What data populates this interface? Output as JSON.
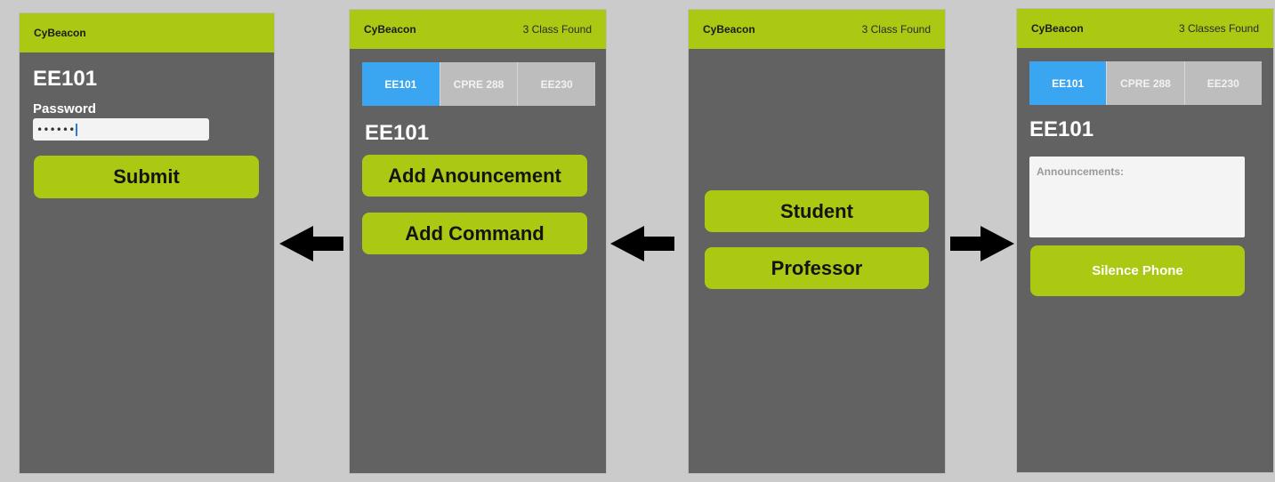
{
  "colors": {
    "background": "#cbcbcb",
    "screen": "#626262",
    "accent": "#abc812",
    "active_tab": "#3aa6f2",
    "inactive_tab": "#bdbdbd"
  },
  "screen1": {
    "brand": "CyBeacon",
    "course": "EE101",
    "password_label": "Password",
    "password_value": "••••••",
    "submit": "Submit"
  },
  "screen2": {
    "brand": "CyBeacon",
    "found": "3 Class Found",
    "tabs": [
      "EE101",
      "CPRE 288",
      "EE230"
    ],
    "active_tab": "EE101",
    "course": "EE101",
    "add_announcement": "Add Anouncement",
    "add_command": "Add Command"
  },
  "screen3": {
    "brand": "CyBeacon",
    "found": "3 Class Found",
    "student": "Student",
    "professor": "Professor"
  },
  "screen4": {
    "brand": "CyBeacon",
    "found": "3 Classes Found",
    "tabs": [
      "EE101",
      "CPRE 288",
      "EE230"
    ],
    "active_tab": "EE101",
    "course": "EE101",
    "announcements_label": "Announcements:",
    "silence": "Silence Phone"
  },
  "arrows": [
    "arrow-left-icon",
    "arrow-left-icon",
    "arrow-right-icon"
  ]
}
